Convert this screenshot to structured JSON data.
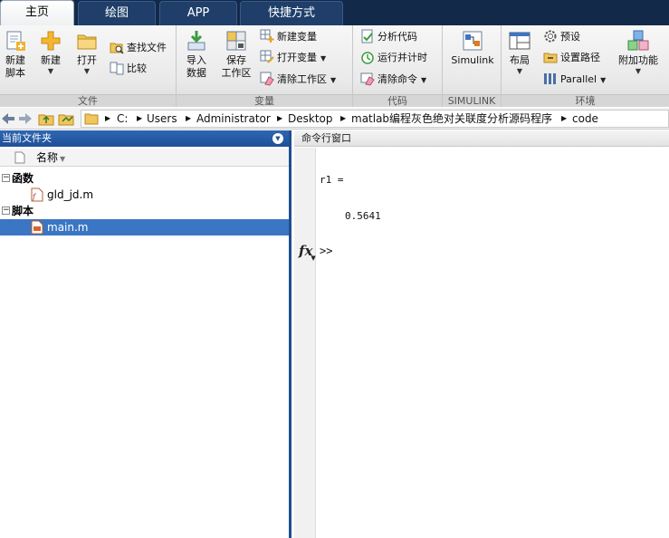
{
  "tabs": [
    "主页",
    "绘图",
    "APP",
    "快捷方式"
  ],
  "ribbon": {
    "file": {
      "label": "文件",
      "new_script": [
        "新建",
        "脚本"
      ],
      "new": "新建",
      "open": "打开",
      "find_files": "查找文件",
      "compare": "比较"
    },
    "variable": {
      "label": "变量",
      "import": [
        "导入",
        "数据"
      ],
      "save": [
        "保存",
        "工作区"
      ],
      "new_variable": "新建变量",
      "open_variable": "打开变量",
      "clear_workspace": "清除工作区"
    },
    "code": {
      "label": "代码",
      "analyze": "分析代码",
      "run_time": "运行并计时",
      "clear_commands": "清除命令"
    },
    "simulink": {
      "label": "SIMULINK",
      "simulink": "Simulink"
    },
    "environment": {
      "label": "环境",
      "layout": "布局",
      "preferences": "预设",
      "set_path": "设置路径",
      "parallel": "Parallel",
      "addons": "附加功能"
    }
  },
  "address": {
    "path": [
      "C:",
      "Users",
      "Administrator",
      "Desktop",
      "matlab编程灰色绝对关联度分析源码程序",
      "code"
    ]
  },
  "folder_panel": {
    "title": "当前文件夹",
    "column_name": "名称",
    "groups": [
      {
        "toggle": "−",
        "label": "函数",
        "files": [
          "gld_jd.m"
        ]
      },
      {
        "toggle": "−",
        "label": "脚本",
        "files": [
          "main.m"
        ]
      }
    ]
  },
  "command_window": {
    "title": "命令行窗口",
    "output_var": "r1 =",
    "output_value": "0.5641",
    "fx": "fx",
    "prompt": ">>"
  },
  "colors": {
    "tabstrip": "#13294a",
    "panel_title": "#1f4f97",
    "selection": "#3b76c4"
  }
}
